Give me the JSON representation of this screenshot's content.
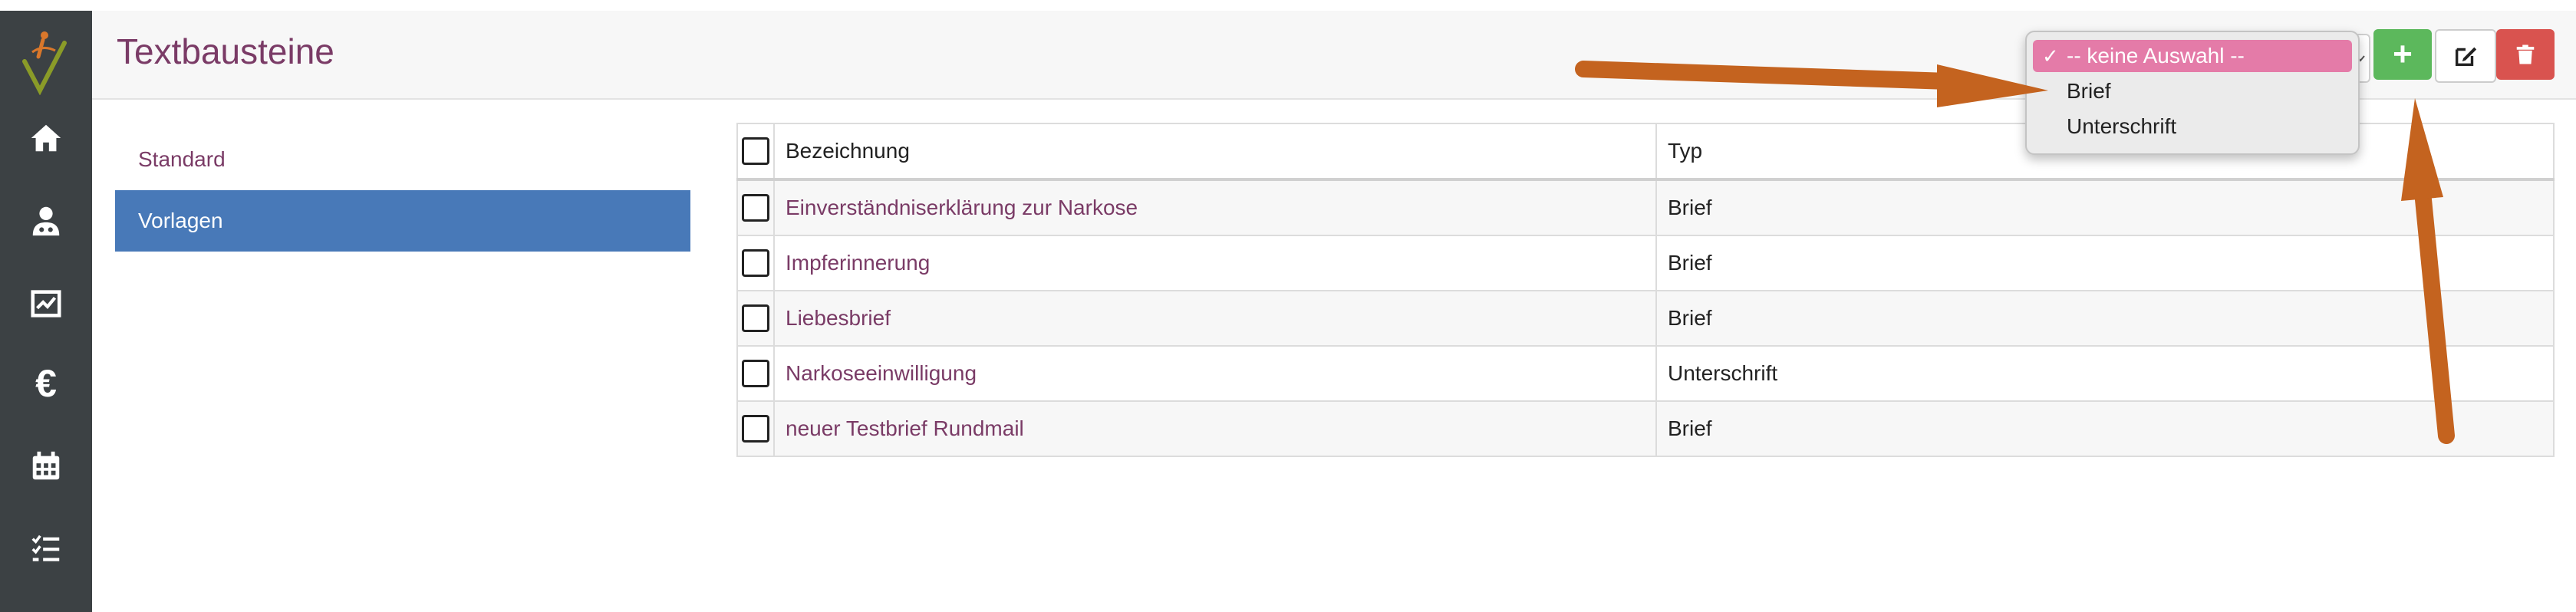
{
  "header": {
    "title": "Textbausteine"
  },
  "sidebar": {
    "icons": [
      "home-icon",
      "user-doctor-icon",
      "chart-icon",
      "euro-icon",
      "calendar-icon",
      "task-list-icon"
    ],
    "euro_symbol": "€"
  },
  "submenu": {
    "items": [
      "Standard",
      "Vorlagen"
    ],
    "active": "Vorlagen"
  },
  "table": {
    "columns": [
      "Bezeichnung",
      "Typ"
    ],
    "rows": [
      {
        "name": "Einverständniserklärung zur Narkose",
        "type": "Brief"
      },
      {
        "name": "Impferinnerung",
        "type": "Brief"
      },
      {
        "name": "Liebesbrief",
        "type": "Brief"
      },
      {
        "name": "Narkoseeinwilligung",
        "type": "Unterschrift"
      },
      {
        "name": "neuer Testbrief Rundmail",
        "type": "Brief"
      }
    ]
  },
  "type_select": {
    "options": [
      "-- keine Auswahl --",
      "Brief",
      "Unterschrift"
    ],
    "selected": "-- keine Auswahl --",
    "check_mark": "✓"
  },
  "toolbar": {
    "add_label": "+",
    "icons": [
      "plus-icon",
      "edit-icon",
      "trash-icon"
    ]
  },
  "colors": {
    "accent": "#7a3b66",
    "active_menu": "#4879b8",
    "add_button": "#5cb85c",
    "delete_button": "#d9534f",
    "selected_option": "#e47ba8",
    "arrow": "#c4631f"
  }
}
